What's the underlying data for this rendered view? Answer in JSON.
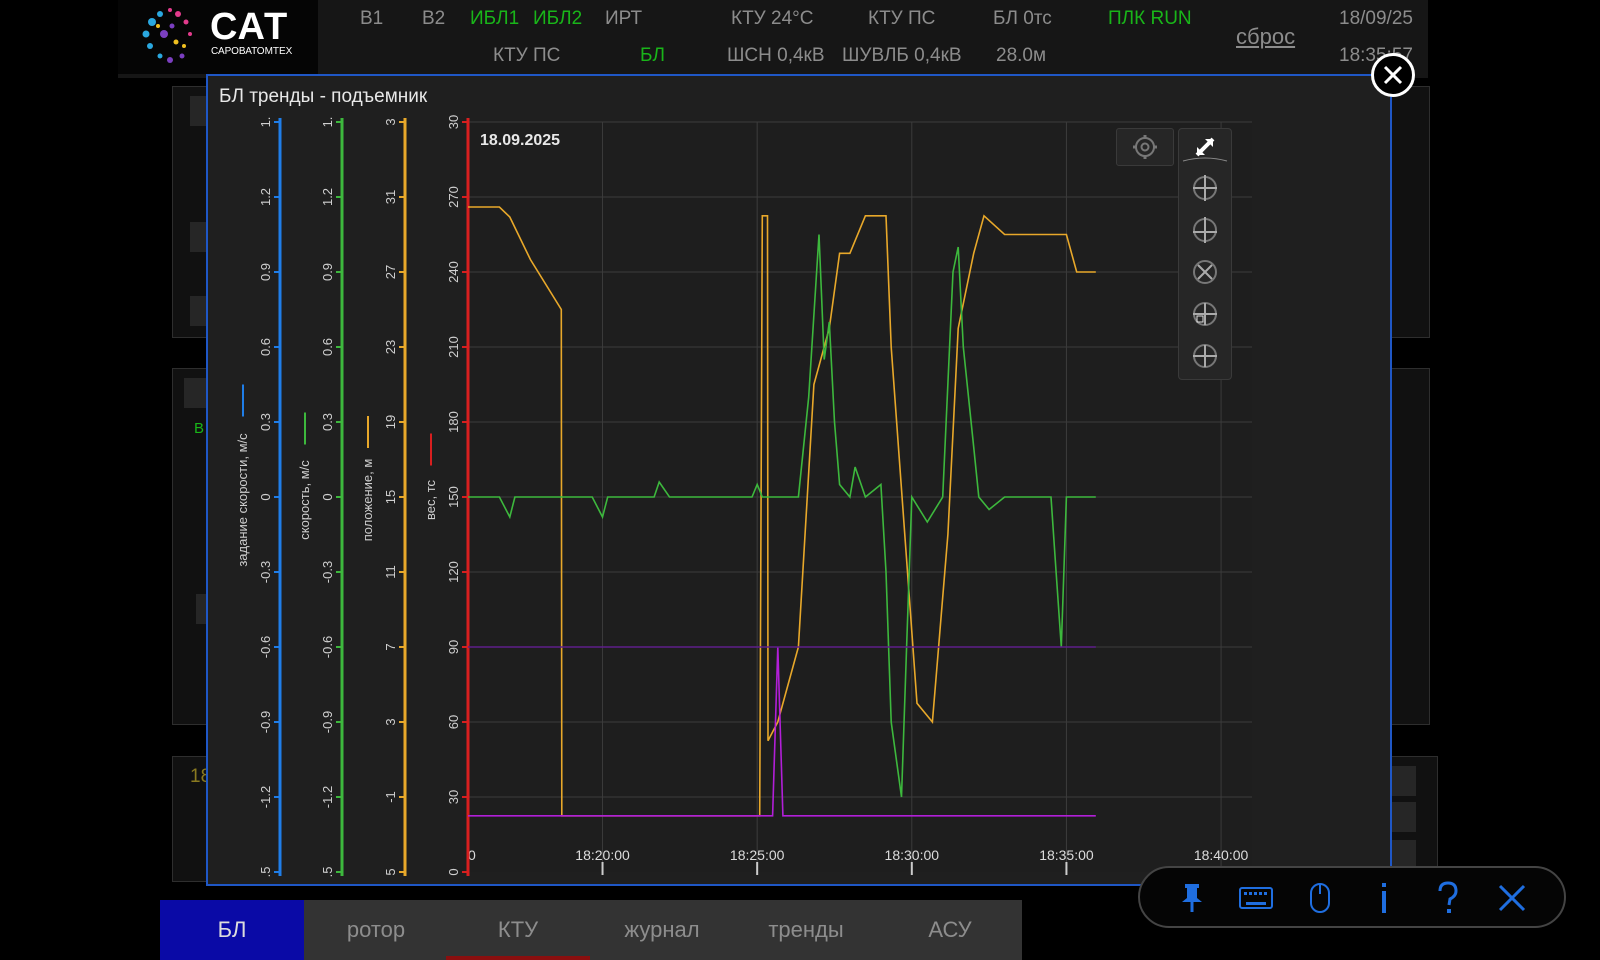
{
  "header": {
    "brand": {
      "title": "САТ",
      "subtitle": "САРОВАТОМТЕХ"
    },
    "status_row1": [
      {
        "text": "В1",
        "color": "gray"
      },
      {
        "text": "В2",
        "color": "gray"
      },
      {
        "text": "ИБЛ1",
        "color": "green"
      },
      {
        "text": "ИБЛ2",
        "color": "green"
      },
      {
        "text": "ИРТ",
        "color": "gray"
      },
      {
        "text": "КТУ 24°С",
        "color": "gray"
      },
      {
        "text": "КТУ ПС",
        "color": "gray"
      },
      {
        "text": "БЛ 0тс",
        "color": "gray"
      },
      {
        "text": "ПЛК RUN",
        "color": "green"
      }
    ],
    "status_row2": [
      {
        "text": "КТУ ПС",
        "color": "gray"
      },
      {
        "text": "БЛ",
        "color": "green"
      },
      {
        "text": "ШСН 0,4кВ",
        "color": "gray"
      },
      {
        "text": "ШУВЛБ 0,4кВ",
        "color": "gray"
      },
      {
        "text": "28.0м",
        "color": "gray"
      }
    ],
    "reset_label": "сброс",
    "date": "18/09/25",
    "time": "18:35:57"
  },
  "background": {
    "row_label": "18",
    "side_label": "В"
  },
  "modal": {
    "title": "БЛ тренды - подъемник"
  },
  "chart_data": {
    "type": "line",
    "date_label": "18.09.2025",
    "x_ticks": [
      "0",
      "18:20:00",
      "18:25:00",
      "18:30:00",
      "18:35:00",
      "18:40:00"
    ],
    "xlim": [
      "18:15:39",
      "18:41:00"
    ],
    "axes": [
      {
        "label": "задание скорости, м/с",
        "color": "#1f7ee8",
        "ticks": [
          ".5",
          "-1.2",
          "-0.9",
          "-0.6",
          "-0.3",
          "0",
          "0.3",
          "0.6",
          "0.9",
          "1.2",
          "1."
        ]
      },
      {
        "label": "скорость, м/с",
        "color": "#3db83d",
        "ticks": [
          ".5",
          "-1.2",
          "-0.9",
          "-0.6",
          "-0.3",
          "0",
          "0.3",
          "0.6",
          "0.9",
          "1.2",
          "1."
        ]
      },
      {
        "label": "положение, м",
        "color": "#e8a82a",
        "ticks": [
          "5",
          "-1",
          "3",
          "7",
          "11",
          "15",
          "19",
          "23",
          "27",
          "31",
          "3"
        ]
      },
      {
        "label": "вес, тс",
        "color": "#d81f1f",
        "ticks": [
          "0",
          "30",
          "60",
          "90",
          "120",
          "150",
          "180",
          "210",
          "240",
          "270",
          "30"
        ]
      }
    ],
    "series": [
      {
        "name": "положение, м",
        "color": "#e8a82a",
        "x": [
          "18:15:39",
          "18:16:40",
          "18:17:00",
          "18:17:40",
          "18:18:40",
          "18:18:41",
          "18:25:05",
          "18:25:10",
          "18:25:20",
          "18:25:21",
          "18:25:40",
          "18:26:20",
          "18:26:50",
          "18:27:20",
          "18:27:40",
          "18:28:00",
          "18:28:30",
          "18:29:00",
          "18:29:10",
          "18:29:20",
          "18:30:10",
          "18:30:40",
          "18:31:10",
          "18:31:30",
          "18:32:00",
          "18:32:20",
          "18:33:00",
          "18:34:00",
          "18:34:30",
          "18:35:00",
          "18:35:20",
          "18:35:57"
        ],
        "y": [
          266,
          266,
          262,
          245,
          225,
          -2,
          -2,
          30,
          30,
          2,
          3,
          7,
          21,
          24,
          28,
          28,
          30,
          30,
          30,
          23,
          4,
          3,
          13,
          24,
          28,
          30,
          29,
          29,
          29,
          29,
          27,
          27
        ]
      },
      {
        "name": "скорость, м/с",
        "color": "#3db83d",
        "x": [
          "18:15:39",
          "18:16:40",
          "18:17:00",
          "18:17:10",
          "18:19:40",
          "18:20:00",
          "18:20:10",
          "18:21:40",
          "18:21:50",
          "18:22:10",
          "18:24:50",
          "18:25:00",
          "18:25:10",
          "18:25:40",
          "18:26:20",
          "18:26:40",
          "18:27:00",
          "18:27:10",
          "18:27:20",
          "18:27:30",
          "18:27:40",
          "18:28:00",
          "18:28:10",
          "18:28:30",
          "18:29:00",
          "18:29:10",
          "18:29:20",
          "18:29:40",
          "18:29:50",
          "18:30:00",
          "18:30:30",
          "18:31:00",
          "18:31:20",
          "18:31:30",
          "18:31:40",
          "18:32:00",
          "18:32:10",
          "18:32:30",
          "18:33:00",
          "18:34:00",
          "18:34:30",
          "18:34:40",
          "18:34:50",
          "18:35:00",
          "18:35:57"
        ],
        "y": [
          0,
          0,
          -0.08,
          0,
          0,
          -0.08,
          0,
          0,
          0.06,
          0,
          0,
          0.05,
          0,
          0,
          0,
          0.4,
          1.05,
          0.55,
          0.7,
          0.3,
          0.05,
          0,
          0.12,
          0,
          0.05,
          -0.3,
          -0.9,
          -1.2,
          -0.6,
          0,
          -0.1,
          0,
          0.9,
          1.0,
          0.6,
          0.2,
          0,
          -0.05,
          0,
          0,
          0,
          -0.3,
          -0.6,
          0,
          0
        ]
      },
      {
        "name": "задание скорости, м/с",
        "color": "#1f7ee8",
        "x": [],
        "y": []
      },
      {
        "name": "вес, тс",
        "color": "#d81f1f",
        "x": [],
        "y": []
      },
      {
        "color": "#b21fd8",
        "x": [
          "18:15:39",
          "18:25:30",
          "18:25:40",
          "18:25:50",
          "18:35:57"
        ],
        "y": [
          -2,
          -2,
          7,
          -2,
          -2
        ]
      },
      {
        "color": "#5e1f8a",
        "x": [
          "18:15:39",
          "18:35:57"
        ],
        "y": [
          7,
          7
        ]
      }
    ],
    "grid": true
  },
  "chart_tools": [
    {
      "icon": "settings-icon"
    },
    {
      "icon": "resize-icon"
    },
    {
      "icon": "pan-vertical-icon"
    },
    {
      "icon": "pan-horizontal-icon"
    },
    {
      "icon": "fit-all-icon"
    },
    {
      "icon": "zoom-horizontal-icon"
    },
    {
      "icon": "zoom-vertical-icon"
    }
  ],
  "tabs": [
    {
      "label": "БЛ",
      "active": true
    },
    {
      "label": "ротор"
    },
    {
      "label": "КТУ"
    },
    {
      "label": "журнал"
    },
    {
      "label": "тренды"
    },
    {
      "label": "АСУ"
    }
  ],
  "float_toolbar": [
    {
      "icon": "pin-icon"
    },
    {
      "icon": "keyboard-icon"
    },
    {
      "icon": "mouse-icon"
    },
    {
      "icon": "info-icon"
    },
    {
      "icon": "help-icon"
    },
    {
      "icon": "close-icon"
    }
  ],
  "colors": {
    "modal_border": "#1f57c6",
    "active_tab": "#0a0aa6",
    "status_ok": "#19b519"
  }
}
